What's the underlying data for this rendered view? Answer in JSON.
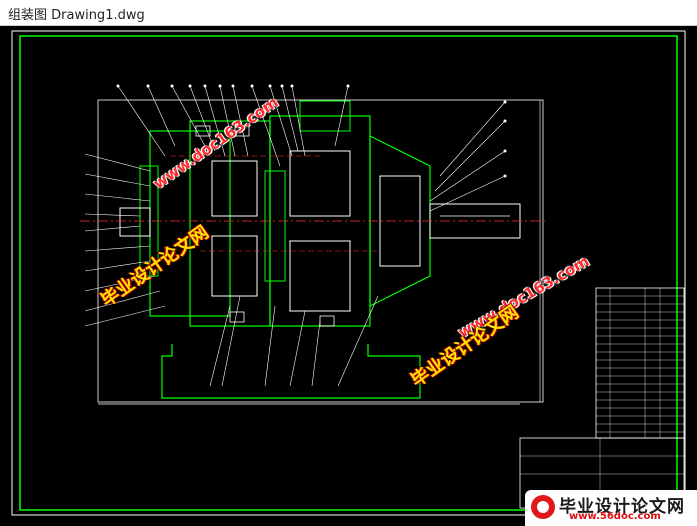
{
  "window": {
    "title": "组装图 Drawing1.dwg"
  },
  "watermarks": {
    "site_a": "www.doc163.com",
    "brand": "毕业设计论文网",
    "site_b": "www.doc163.com",
    "brand_b": "毕业设计论文网"
  },
  "logo": {
    "brand": "毕业设计论文网",
    "url": "www.56doc.com"
  },
  "colors": {
    "background": "#000000",
    "frame_green": "#00ff00",
    "outline_white": "#ffffff",
    "centerline_red": "#ff3030",
    "watermark_red": "#ff2a2a",
    "watermark_yellow": "#ffe600"
  }
}
